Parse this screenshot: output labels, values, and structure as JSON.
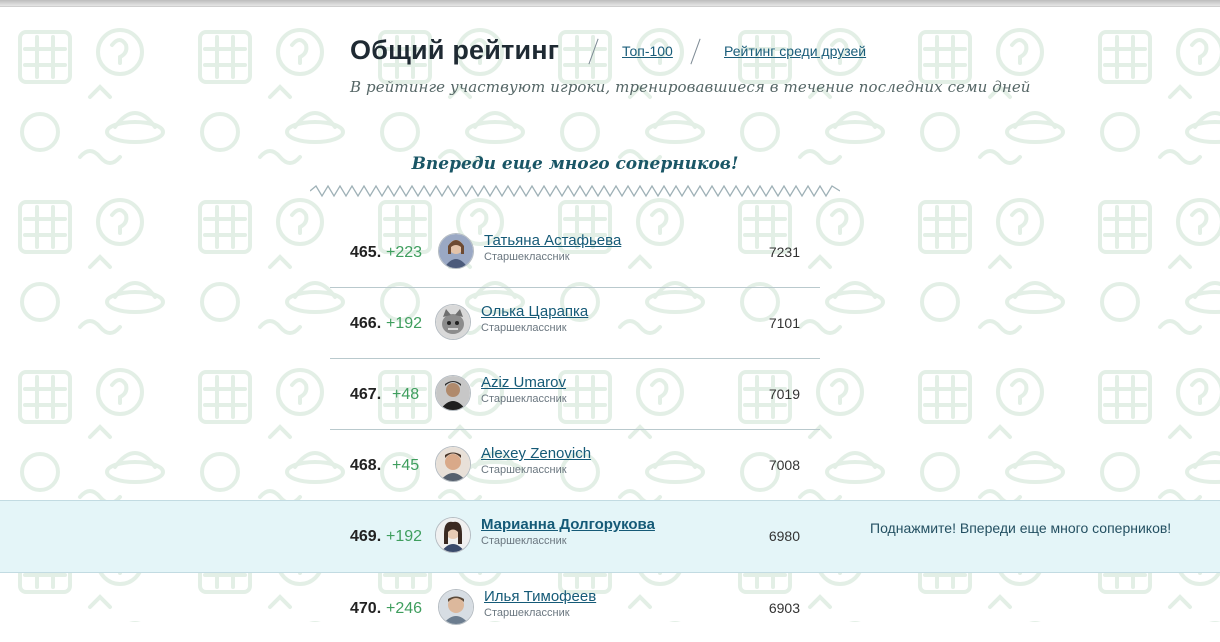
{
  "header": {
    "title": "Общий рейтинг",
    "links": [
      "Топ-100",
      "Рейтинг среди друзей"
    ],
    "subtitle": "В рейтинге участвуют игроки, тренировавшиеся в течение последних семи дней"
  },
  "section_title": "Впереди еще много соперников!",
  "highlight_note": "Поднажмите! Впереди еще много соперников!",
  "rows": [
    {
      "rank": "465.",
      "delta": "+223",
      "name": "Татьяна Астафьева",
      "status": "Старшеклассник",
      "score": "7231"
    },
    {
      "rank": "466.",
      "delta": "+192",
      "name": "Олька Царапка",
      "status": "Старшеклассник",
      "score": "7101"
    },
    {
      "rank": "467.",
      "delta": "+48",
      "name": "Aziz Umarov",
      "status": "Старшеклассник",
      "score": "7019"
    },
    {
      "rank": "468.",
      "delta": "+45",
      "name": "Alexey Zenovich",
      "status": "Старшеклассник",
      "score": "7008"
    },
    {
      "rank": "469.",
      "delta": "+192",
      "name": "Марианна Долгорукова",
      "status": "Старшеклассник",
      "score": "6980",
      "current_user": true
    },
    {
      "rank": "470.",
      "delta": "+246",
      "name": "Илья Тимофеев",
      "status": "Старшеклассник",
      "score": "6903"
    }
  ],
  "colors": {
    "accent": "#155a77",
    "delta_green": "#3f9e5e",
    "highlight_bg": "#e4f5f8"
  }
}
